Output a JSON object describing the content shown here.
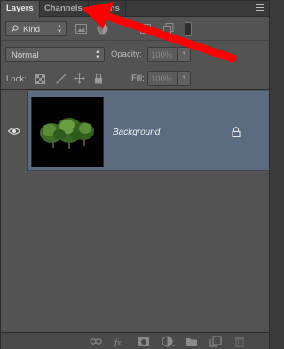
{
  "tabs": [
    {
      "label": "Layers",
      "active": true
    },
    {
      "label": "Channels",
      "active": false
    },
    {
      "label": "Paths",
      "active": false
    }
  ],
  "filter": {
    "kind_label": "Kind"
  },
  "blend": {
    "mode": "Normal",
    "opacity_label": "Opacity:",
    "opacity_value": "100%"
  },
  "lock": {
    "lock_label": "Lock:",
    "fill_label": "Fill:",
    "fill_value": "100%"
  },
  "layers": [
    {
      "name": "Background",
      "visible": true,
      "locked": true
    }
  ],
  "colors": {
    "selected_row": "#5b6b80",
    "annotation": "#ff0000",
    "panel": "#535353"
  },
  "bottom_icons": [
    "link-icon",
    "fx-icon",
    "mask-icon",
    "adjustment-icon",
    "folder-icon",
    "new-layer-icon",
    "trash-icon"
  ]
}
